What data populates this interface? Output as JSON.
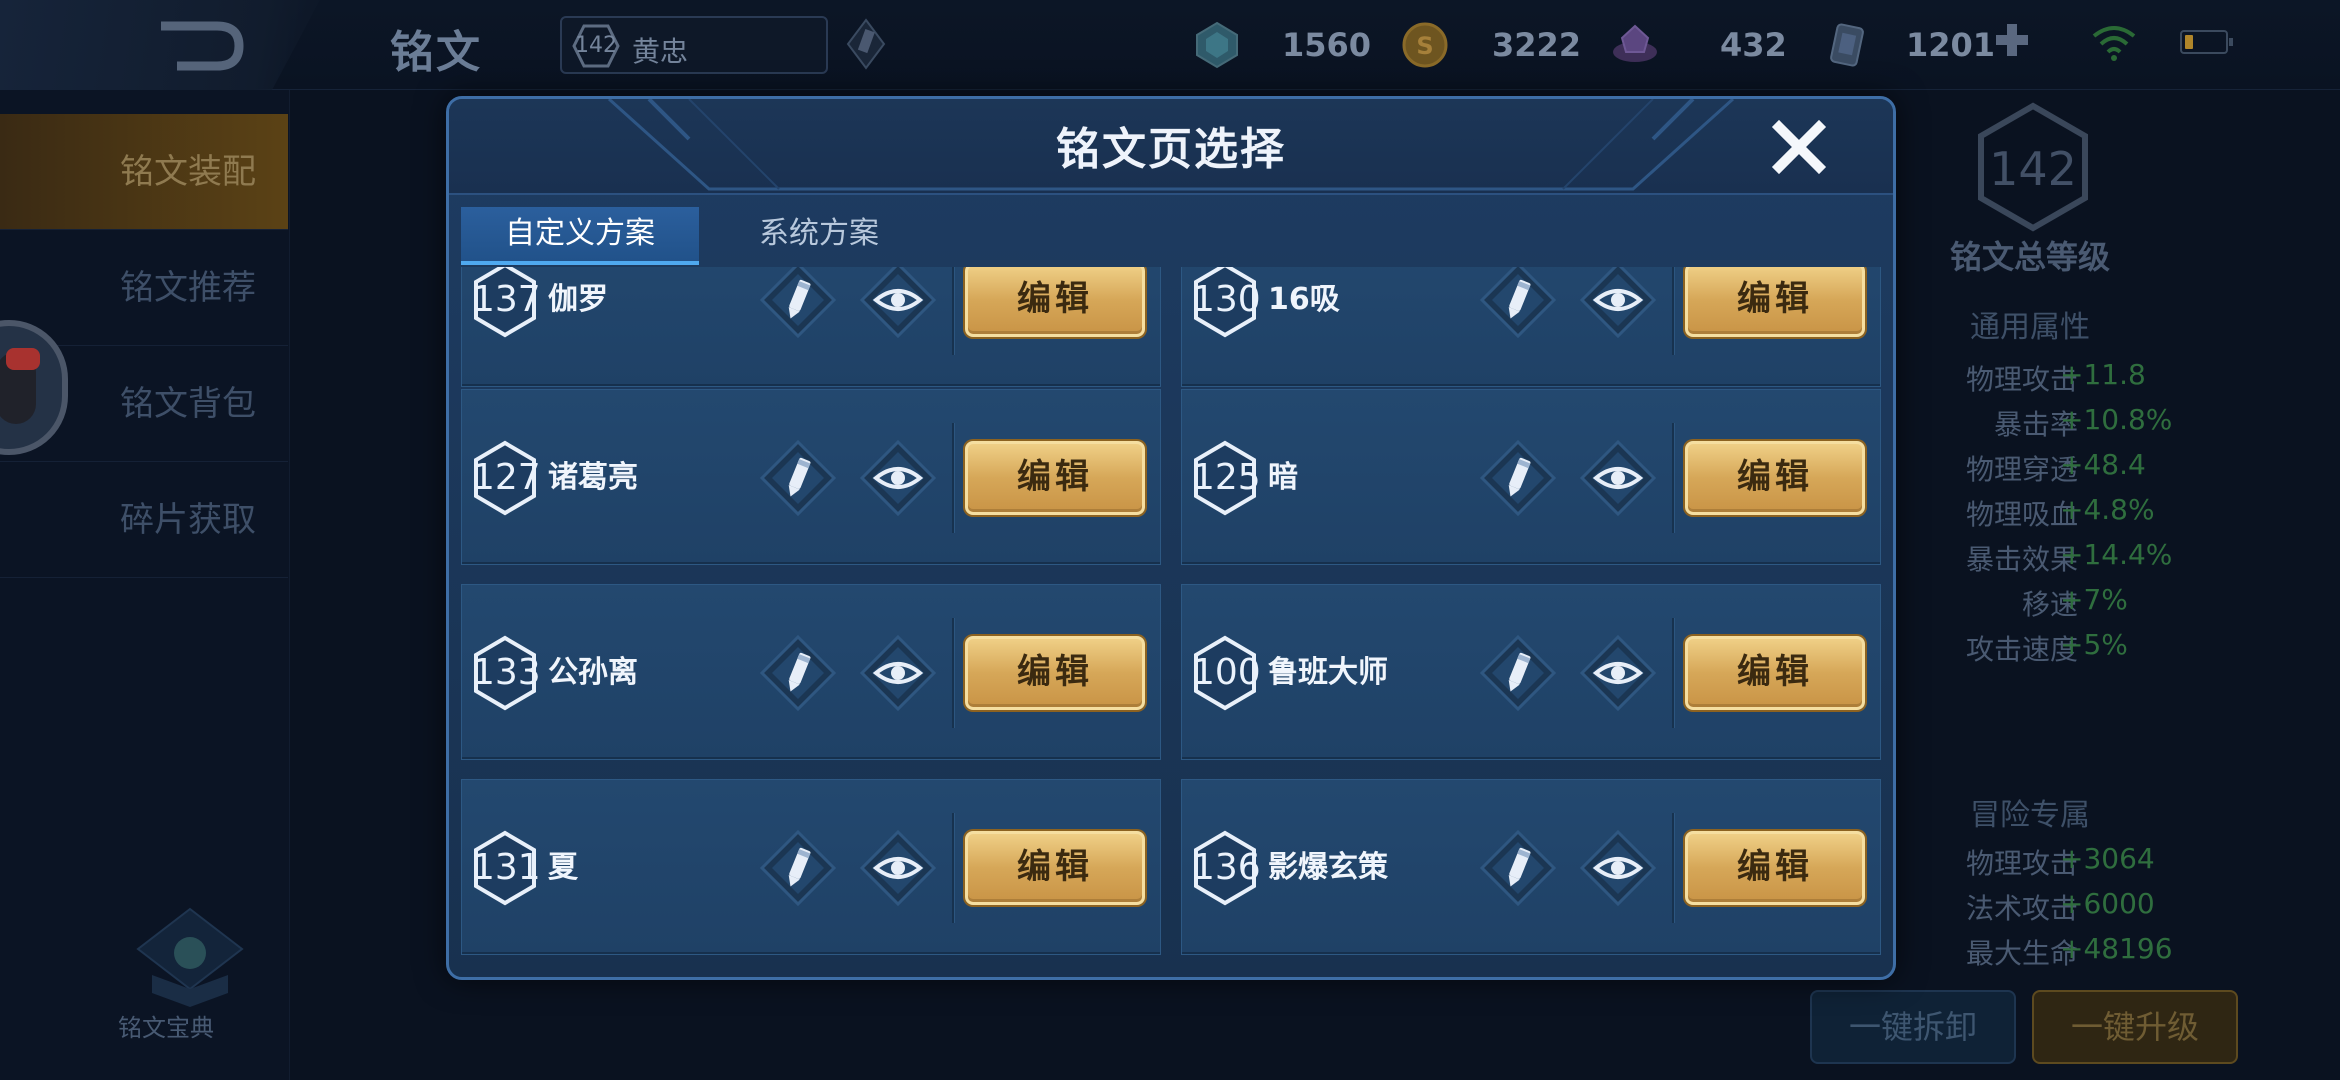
{
  "topbar": {
    "title": "铭文",
    "hero_level": "142",
    "hero_name": "黄忠",
    "currencies": [
      {
        "icon": "gem-icon",
        "value": "1560"
      },
      {
        "icon": "gold-coin-icon",
        "value": "3222"
      },
      {
        "icon": "crystal-icon",
        "value": "432"
      },
      {
        "icon": "card-icon",
        "value": "1201"
      }
    ]
  },
  "sidebar": {
    "items": [
      {
        "label": "铭文装配"
      },
      {
        "label": "铭文推荐"
      },
      {
        "label": "铭文背包"
      },
      {
        "label": "碎片获取"
      }
    ],
    "codex_label": "铭文宝典"
  },
  "right_panel": {
    "total_level": "142",
    "total_level_label": "铭文总等级",
    "general_title": "通用属性",
    "general_attrs": [
      {
        "k": "物理攻击",
        "v": "+11.8"
      },
      {
        "k": "暴击率",
        "v": "+10.8%"
      },
      {
        "k": "物理穿透",
        "v": "+48.4"
      },
      {
        "k": "物理吸血",
        "v": "+4.8%"
      },
      {
        "k": "暴击效果",
        "v": "+14.4%"
      },
      {
        "k": "移速",
        "v": "+7%"
      },
      {
        "k": "攻击速度",
        "v": "+5%"
      }
    ],
    "adventure_title": "冒险专属",
    "adventure_attrs": [
      {
        "k": "物理攻击",
        "v": "+3064"
      },
      {
        "k": "法术攻击",
        "v": "+6000"
      },
      {
        "k": "最大生命",
        "v": "+48196"
      }
    ],
    "dismantle_label": "一键拆卸",
    "upgrade_label": "一键升级"
  },
  "modal": {
    "title": "铭文页选择",
    "tabs": [
      {
        "label": "自定义方案"
      },
      {
        "label": "系统方案"
      }
    ],
    "edit_label": "编辑",
    "pages": [
      {
        "level": "137",
        "name": "伽罗"
      },
      {
        "level": "130",
        "name": "16吸"
      },
      {
        "level": "127",
        "name": "诸葛亮"
      },
      {
        "level": "125",
        "name": "暗"
      },
      {
        "level": "133",
        "name": "公孙离"
      },
      {
        "level": "100",
        "name": "鲁班大师"
      },
      {
        "level": "131",
        "name": "夏"
      },
      {
        "level": "136",
        "name": "影爆玄策"
      }
    ]
  },
  "colors": {
    "accent_blue": "#4fa9ef",
    "gold_button": "#d6a758",
    "stat_green": "#2f6e3e"
  }
}
